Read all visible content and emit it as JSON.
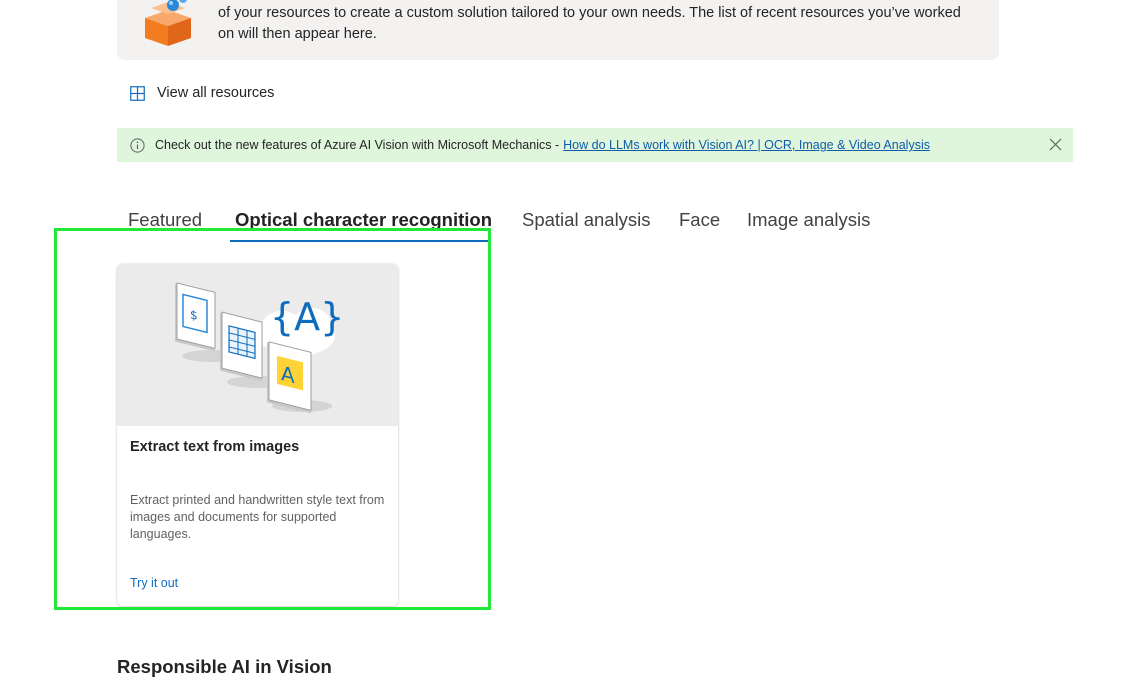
{
  "intro_card": {
    "line1": "of your resources to create a custom solution tailored to your own needs. The list of recent resources you’ve worked",
    "line2": "on will then appear here."
  },
  "view_all": {
    "label": "View all resources"
  },
  "message_bar": {
    "text": "Check out the new features of Azure AI Vision with Microsoft Mechanics -",
    "link": "How do LLMs work with Vision AI? | OCR, Image & Video Analysis"
  },
  "tabs": [
    {
      "label": "Featured",
      "active": false
    },
    {
      "label": "Optical character recognition",
      "active": true
    },
    {
      "label": "Spatial analysis",
      "active": false
    },
    {
      "label": "Face",
      "active": false
    },
    {
      "label": "Image analysis",
      "active": false
    }
  ],
  "card": {
    "title": "Extract text from images",
    "description": "Extract printed and handwritten style text from images and documents for supported languages.",
    "link": "Try it out"
  },
  "section": {
    "title": "Responsible AI in Vision"
  },
  "colors": {
    "accent": "#0f6cbd",
    "message_bg": "#dff6dd",
    "highlight": "#22e83a"
  }
}
